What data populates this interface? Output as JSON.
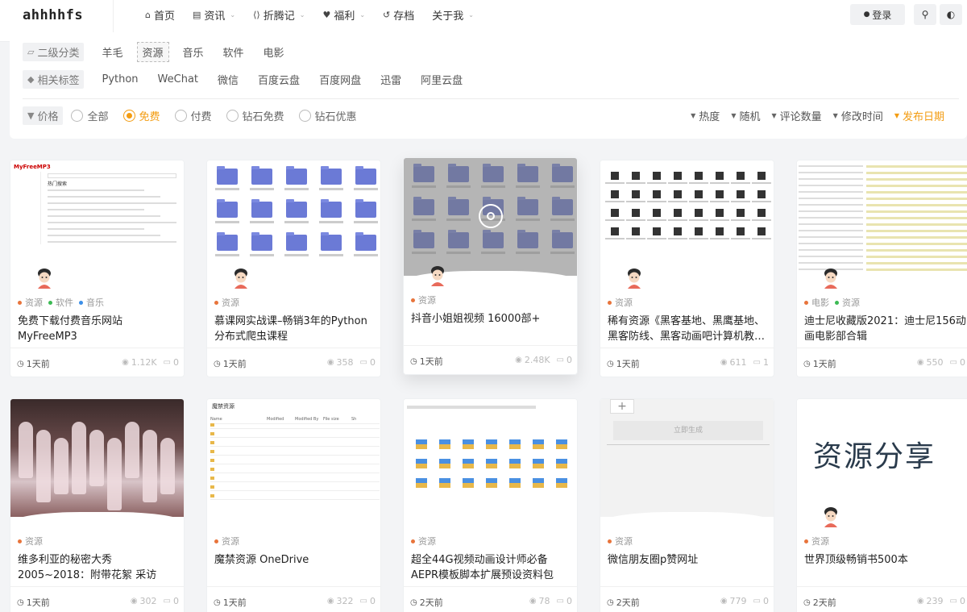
{
  "header": {
    "logo": "ahhhhfs",
    "nav": [
      {
        "label": "首页",
        "icon": "home-icon",
        "glyph": "⌂",
        "dropdown": false
      },
      {
        "label": "资讯",
        "icon": "news-icon",
        "glyph": "▤",
        "dropdown": true
      },
      {
        "label": "折腾记",
        "icon": "code-icon",
        "glyph": "⟨⟩",
        "dropdown": true
      },
      {
        "label": "福利",
        "icon": "heart-icon",
        "glyph": "♥",
        "dropdown": true
      },
      {
        "label": "存档",
        "icon": "history-icon",
        "glyph": "↺",
        "dropdown": false
      },
      {
        "label": "关于我",
        "icon": "",
        "glyph": "",
        "dropdown": true
      }
    ],
    "login_label": "登录"
  },
  "filter": {
    "category_label": "二级分类",
    "categories": [
      "羊毛",
      "资源",
      "音乐",
      "软件",
      "电影"
    ],
    "active_category": "资源",
    "tags_label": "相关标签",
    "tags": [
      "Python",
      "WeChat",
      "微信",
      "百度云盘",
      "百度网盘",
      "迅雷",
      "阿里云盘"
    ],
    "price_label": "价格",
    "prices": [
      "全部",
      "免费",
      "付费",
      "钻石免费",
      "钻石优惠"
    ],
    "active_price": "免费",
    "sorts": [
      "热度",
      "随机",
      "评论数量",
      "修改时间",
      "发布日期"
    ],
    "active_sort": "发布日期"
  },
  "colors": {
    "accent": "#f39c12",
    "folder": "#6b7ad6"
  },
  "cards": [
    {
      "tags": [
        {
          "name": "资源",
          "color": "#e8743b"
        },
        {
          "name": "软件",
          "color": "#3cba54"
        },
        {
          "name": "音乐",
          "color": "#3b8fe8"
        }
      ],
      "title": "免费下载付费音乐网站 MyFreeMP3",
      "time": "1天前",
      "views": "1.12K",
      "comments": "0",
      "thumb": "myfree",
      "thumb_text": "MyFreeMP3",
      "thumb_sub": "热门搜索"
    },
    {
      "tags": [
        {
          "name": "资源",
          "color": "#e8743b"
        }
      ],
      "title": "慕课网实战课–畅销3年的Python分布式爬虫课程",
      "time": "1天前",
      "views": "358",
      "comments": "0",
      "thumb": "folders"
    },
    {
      "tags": [
        {
          "name": "资源",
          "color": "#e8743b"
        }
      ],
      "title": "抖音小姐姐视频 16000部+",
      "time": "1天前",
      "views": "2.48K",
      "comments": "0",
      "thumb": "folders-video"
    },
    {
      "tags": [
        {
          "name": "资源",
          "color": "#e8743b"
        }
      ],
      "title": "稀有资源《黑客基地、黑鹰基地、黑客防线、黑客动画吧计算机教…",
      "time": "1天前",
      "views": "611",
      "comments": "1",
      "thumb": "files"
    },
    {
      "tags": [
        {
          "name": "电影",
          "color": "#e8743b"
        },
        {
          "name": "资源",
          "color": "#3cba54"
        }
      ],
      "title": "迪士尼收藏版2021：迪士尼156动画电影部合辑",
      "time": "1天前",
      "views": "550",
      "comments": "0",
      "thumb": "list"
    },
    {
      "tags": [
        {
          "name": "资源",
          "color": "#e8743b"
        }
      ],
      "title": "维多利亚的秘密大秀2005~2018：附带花絮 采访",
      "time": "1天前",
      "views": "302",
      "comments": "0",
      "thumb": "photo"
    },
    {
      "tags": [
        {
          "name": "资源",
          "color": "#e8743b"
        }
      ],
      "title": "魔禁资源 OneDrive",
      "time": "1天前",
      "views": "322",
      "comments": "0",
      "thumb": "onedrive",
      "thumb_text": "魔禁资源",
      "thumb_cols": [
        "Name",
        "Modified",
        "Modified By",
        "File size",
        "Sh"
      ]
    },
    {
      "tags": [
        {
          "name": "资源",
          "color": "#e8743b"
        }
      ],
      "title": "超全44G视频动画设计师必备AEPR模板脚本扩展预设资料包",
      "time": "2天前",
      "views": "78",
      "comments": "0",
      "thumb": "icons"
    },
    {
      "tags": [
        {
          "name": "资源",
          "color": "#e8743b"
        }
      ],
      "title": "微信朋友圈p赞网址",
      "time": "2天前",
      "views": "779",
      "comments": "0",
      "thumb": "wechat",
      "thumb_text": "立即生成",
      "thumb_plus": "+"
    },
    {
      "tags": [
        {
          "name": "资源",
          "color": "#e8743b"
        }
      ],
      "title": "世界顶级畅销书500本",
      "time": "2天前",
      "views": "239",
      "comments": "0",
      "thumb": "text",
      "thumb_text": "资源分享"
    }
  ]
}
